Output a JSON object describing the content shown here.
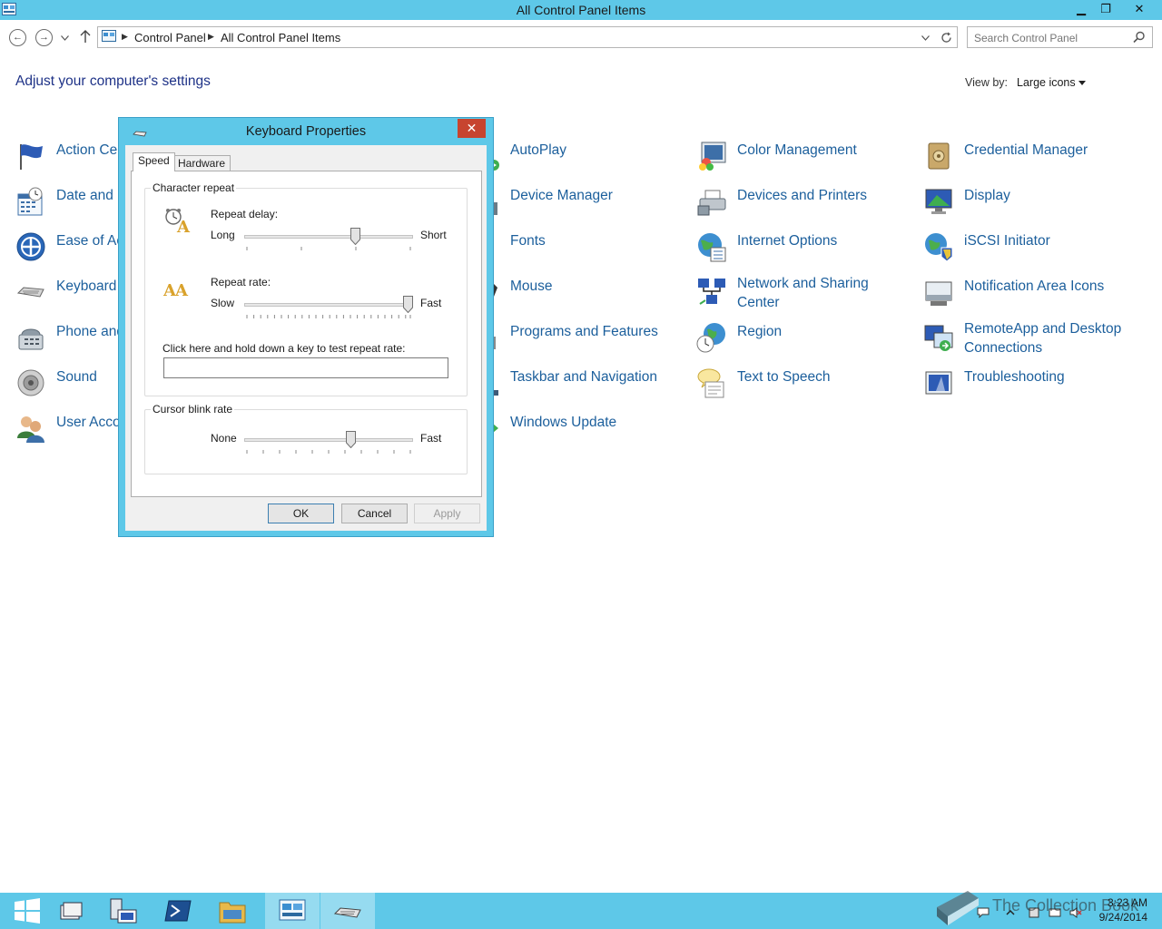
{
  "window": {
    "title": "All Control Panel Items",
    "minimize": "▁",
    "restore": "❐",
    "close": "✕"
  },
  "address_bar": {
    "breadcrumb": [
      "Control Panel",
      "All Control Panel Items"
    ],
    "search_placeholder": "Search Control Panel"
  },
  "page": {
    "heading": "Adjust your computer's settings",
    "view_by_label": "View by:",
    "view_by_value": "Large icons"
  },
  "items": {
    "col1": [
      "Action Ce",
      "Date and ",
      "Ease of Ac",
      "Keyboard",
      "Phone and",
      "Sound",
      "User Acco"
    ],
    "col2": [
      "AutoPlay",
      "Device Manager",
      "Fonts",
      "Mouse",
      "Programs and Features",
      "Taskbar and Navigation",
      "Windows Update"
    ],
    "col3": [
      "Color Management",
      "Devices and Printers",
      "Internet Options",
      "Network and Sharing Center",
      "Region",
      "Text to Speech"
    ],
    "col4": [
      "Credential Manager",
      "Display",
      "iSCSI Initiator",
      "Notification Area Icons",
      "RemoteApp and Desktop Connections",
      "Troubleshooting"
    ]
  },
  "dialog": {
    "title": "Keyboard Properties",
    "close": "✕",
    "tabs": [
      "Speed",
      "Hardware"
    ],
    "character_repeat": {
      "group_title": "Character repeat",
      "repeat_delay_label": "Repeat delay:",
      "delay_min": "Long",
      "delay_max": "Short",
      "delay_value": 0.66,
      "repeat_rate_label": "Repeat rate:",
      "rate_min": "Slow",
      "rate_max": "Fast",
      "rate_value": 0.97,
      "test_label": "Click here and hold down a key to test repeat rate:",
      "test_value": ""
    },
    "cursor_blink": {
      "group_title": "Cursor blink rate",
      "min": "None",
      "max": "Fast",
      "value": 0.63
    },
    "buttons": {
      "ok": "OK",
      "cancel": "Cancel",
      "apply": "Apply"
    }
  },
  "taskbar": {
    "time": "3:23 AM",
    "date": "9/24/2014",
    "watermark": "The Collection Book"
  },
  "colors": {
    "chrome": "#5ec8e8",
    "link": "#1c5f9c",
    "heading": "#1e3287",
    "close_red": "#c7442f"
  }
}
